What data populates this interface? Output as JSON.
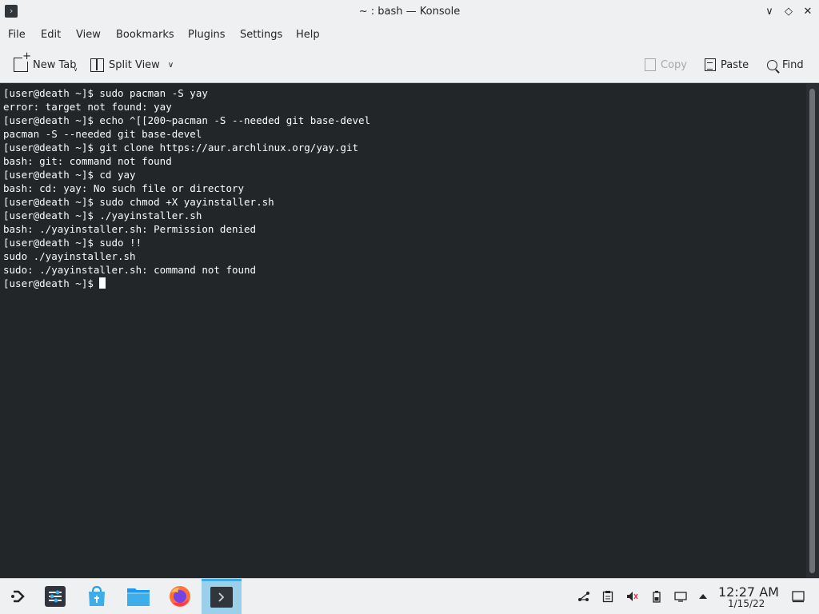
{
  "window": {
    "title": "~ : bash — Konsole",
    "controls": {
      "minimize": "∨",
      "maximize": "◇",
      "close": "✕"
    }
  },
  "menu": [
    "File",
    "Edit",
    "View",
    "Bookmarks",
    "Plugins",
    "Settings",
    "Help"
  ],
  "toolbar": {
    "new_tab": "New Tab",
    "split_view": "Split View",
    "copy": "Copy",
    "paste": "Paste",
    "find": "Find"
  },
  "terminal": {
    "lines": [
      "[user@death ~]$ sudo pacman -S yay",
      "error: target not found: yay",
      "[user@death ~]$ echo ^[[200~pacman -S --needed git base-devel",
      "pacman -S --needed git base-devel",
      "[user@death ~]$ git clone https://aur.archlinux.org/yay.git",
      "bash: git: command not found",
      "[user@death ~]$ cd yay",
      "bash: cd: yay: No such file or directory",
      "[user@death ~]$ sudo chmod +X yayinstaller.sh",
      "[user@death ~]$ ./yayinstaller.sh",
      "bash: ./yayinstaller.sh: Permission denied",
      "[user@death ~]$ sudo !!",
      "sudo ./yayinstaller.sh",
      "sudo: ./yayinstaller.sh: command not found"
    ],
    "prompt": "[user@death ~]$ "
  },
  "taskbar": {
    "apps": [
      {
        "name": "application-launcher-icon"
      },
      {
        "name": "system-settings-icon"
      },
      {
        "name": "discover-store-icon"
      },
      {
        "name": "dolphin-files-icon"
      },
      {
        "name": "firefox-icon"
      },
      {
        "name": "konsole-icon",
        "active": true
      }
    ],
    "tray": [
      "network-icon",
      "clipboard-icon",
      "volume-muted-icon",
      "battery-icon",
      "display-icon",
      "tray-expand-icon",
      "show-desktop-icon"
    ],
    "clock_time": "12:27 AM",
    "clock_date": "1/15/22"
  },
  "colors": {
    "terminal_bg": "#232629",
    "terminal_fg": "#fcfcfc",
    "chrome_bg": "#eff0f1",
    "accent": "#3daee9"
  }
}
